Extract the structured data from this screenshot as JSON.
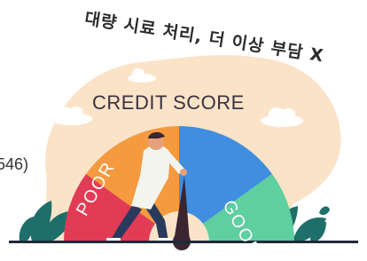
{
  "headline": "대량 시료 처리, 더 이상 부담 X",
  "side_text": "546)",
  "gauge": {
    "title": "CREDIT SCORE",
    "low_label": "POOR",
    "high_label": "GOOD"
  },
  "colors": {
    "blob": "#fbe3c8",
    "red": "#e23b55",
    "orange": "#f59a3f",
    "blue": "#3f8ee0",
    "teal": "#5ecf9f",
    "plant": "#1e6f6a",
    "needle": "#3a2530",
    "shirt": "#f3f4ee",
    "pants": "#2a3a5c"
  }
}
